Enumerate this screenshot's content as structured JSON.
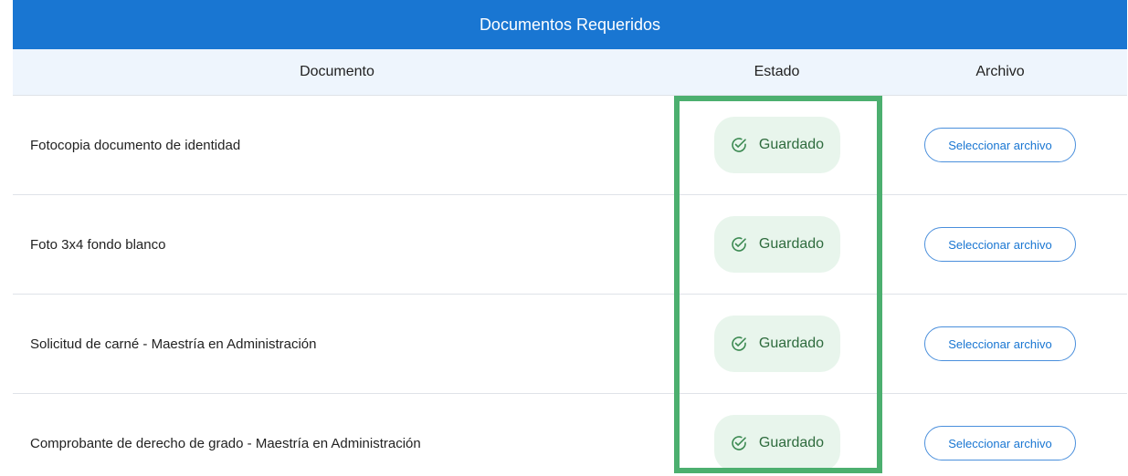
{
  "panel": {
    "title": "Documentos Requeridos"
  },
  "columns": {
    "document": "Documento",
    "state": "Estado",
    "file": "Archivo"
  },
  "rows": [
    {
      "document": "Fotocopia documento de identidad",
      "state": "Guardado",
      "file_button": "Seleccionar archivo"
    },
    {
      "document": "Foto 3x4 fondo blanco",
      "state": "Guardado",
      "file_button": "Seleccionar archivo"
    },
    {
      "document": "Solicitud de carné - Maestría en Administración",
      "state": "Guardado",
      "file_button": "Seleccionar archivo"
    },
    {
      "document": "Comprobante de derecho de grado - Maestría en Administración",
      "state": "Guardado",
      "file_button": "Seleccionar archivo"
    }
  ],
  "icons": {
    "state": "check-circle-icon"
  },
  "colors": {
    "header_blue": "#1976d2",
    "badge_bg": "#e8f5ec",
    "badge_text": "#2e6b3d",
    "highlight": "#4caf6f"
  }
}
